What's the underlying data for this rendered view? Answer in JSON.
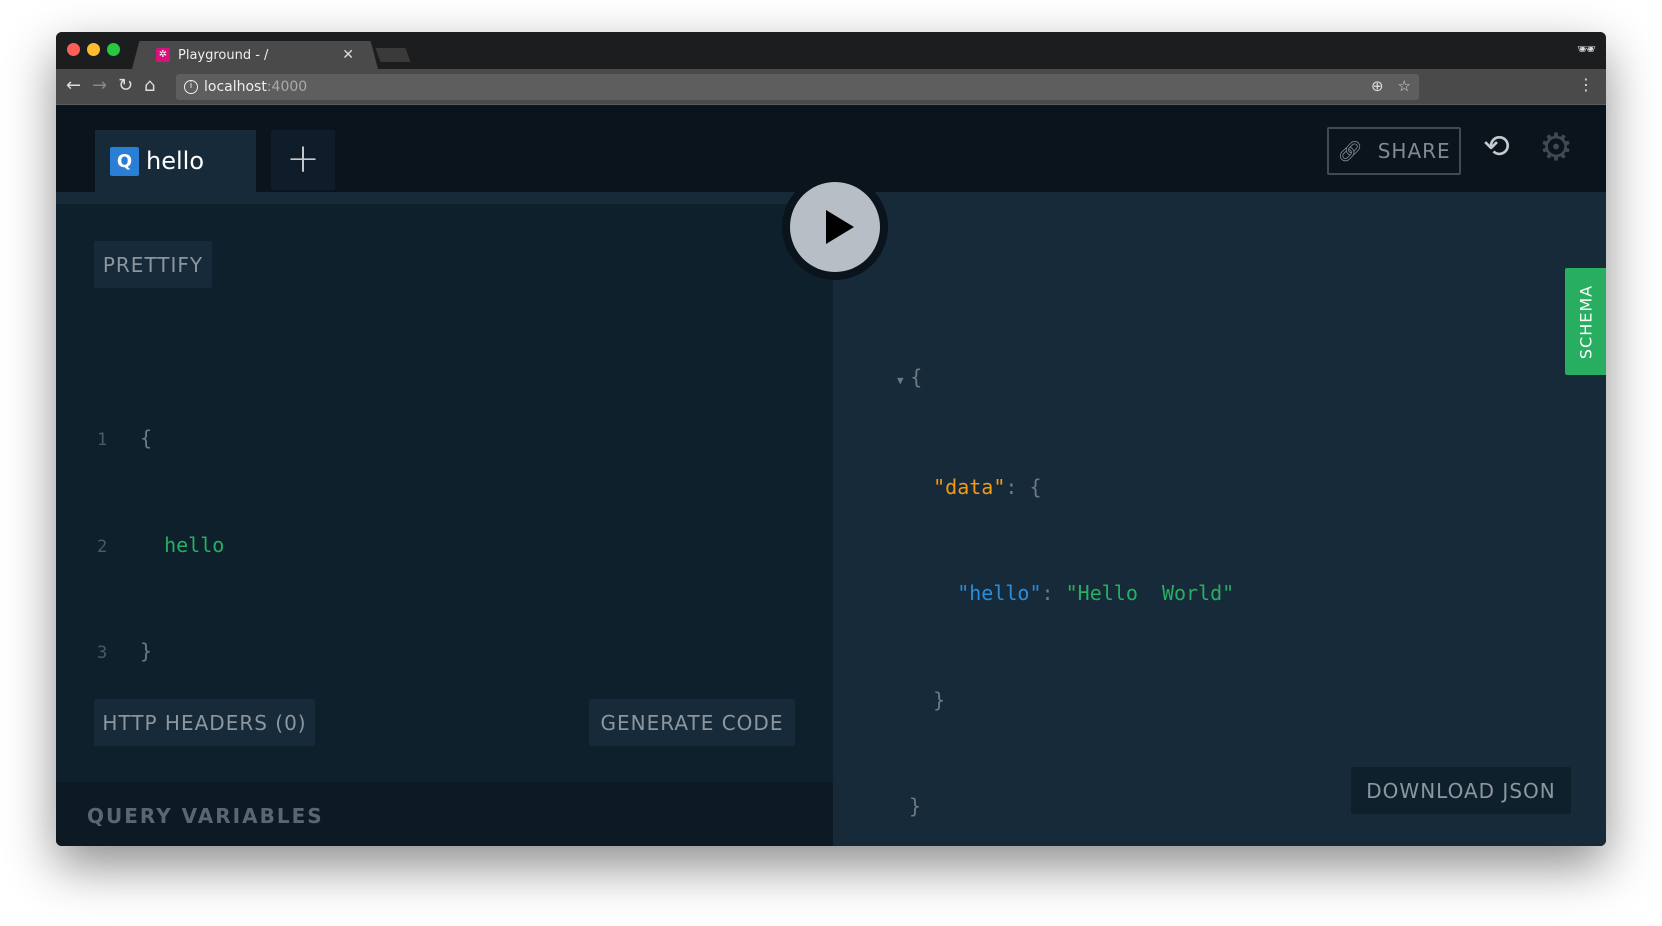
{
  "browser": {
    "tab_title": "Playground - /",
    "url_host": "localhost",
    "url_port": ":4000"
  },
  "header": {
    "query_tab": {
      "badge": "Q",
      "label": "hello"
    },
    "add_tab": "+",
    "share": "SHARE"
  },
  "editor": {
    "prettify": "PRETTIFY",
    "line_numbers": [
      "1",
      "2",
      "3"
    ],
    "lines": [
      "{",
      "  hello",
      "}"
    ],
    "http_headers": "HTTP HEADERS (0)",
    "generate_code": "GENERATE CODE",
    "query_variables": "QUERY VARIABLES"
  },
  "result": {
    "open_brace": "{",
    "key_data": "\"data\"",
    "colon": ":",
    "inner_open": "{",
    "key_hello": "\"hello\"",
    "value_hello": "\"Hello  World\"",
    "inner_close": "}",
    "close_brace": "}",
    "download_json": "DOWNLOAD JSON"
  },
  "schema_tab": "SCHEMA",
  "colors": {
    "accent_green": "#27ae60",
    "query_badge": "#2a7ed3",
    "json_key": "#f39c12",
    "field_key": "#2b8cd8"
  }
}
